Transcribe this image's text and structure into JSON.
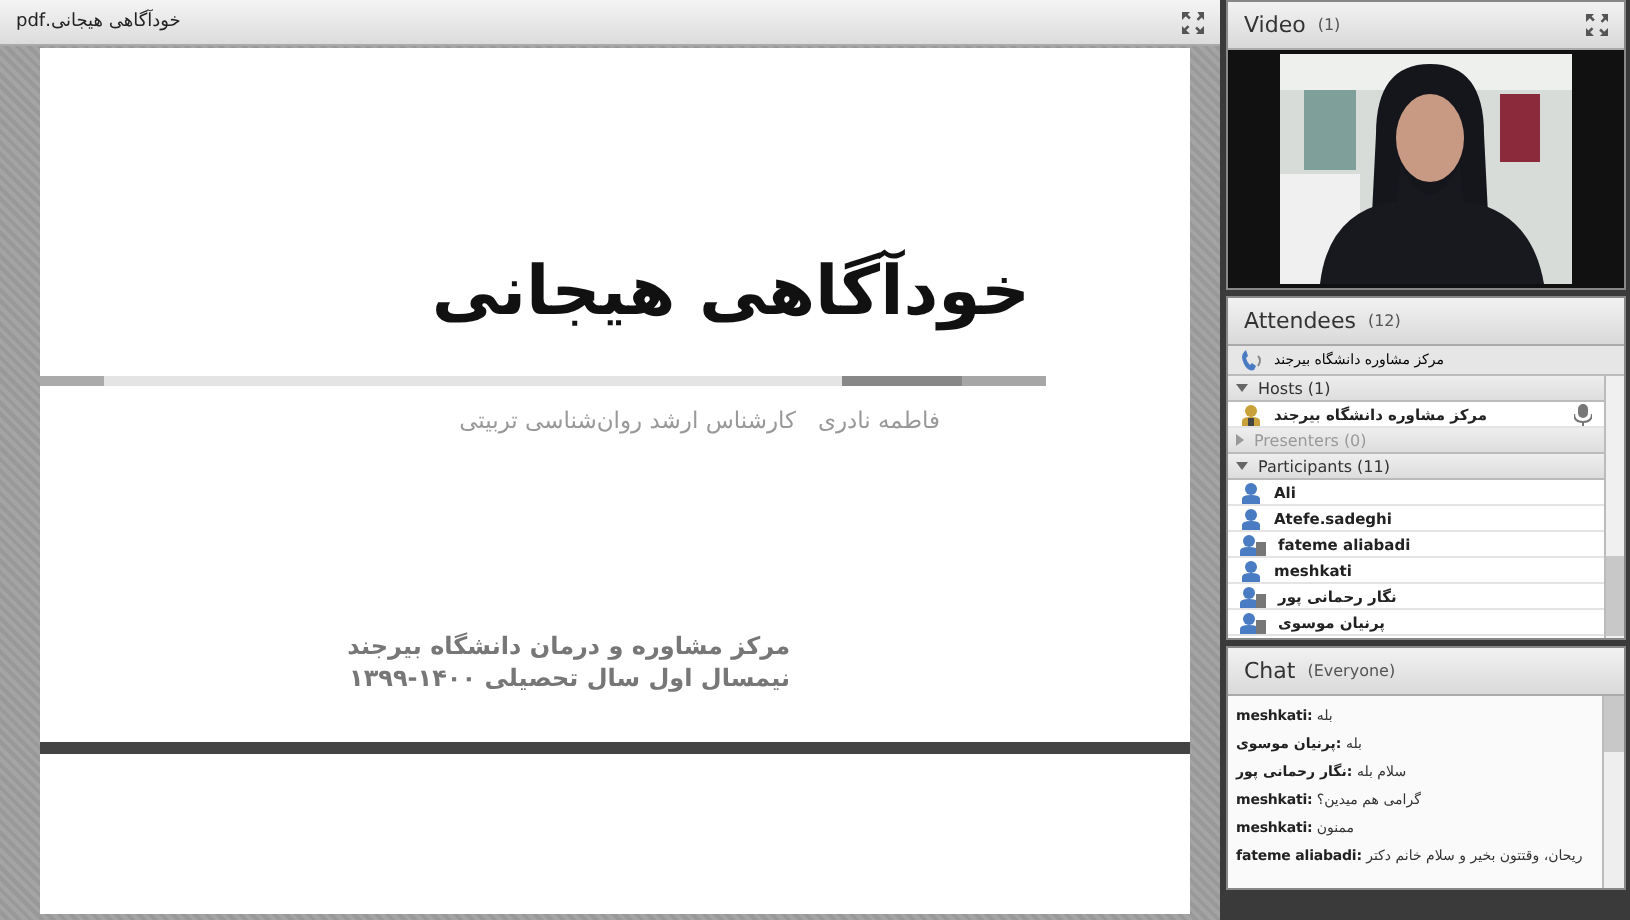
{
  "document_pod": {
    "title": "خودآگاهی هیجانی.pdf",
    "slide": {
      "title": "خودآگاهی هیجانی",
      "presenter": "فاطمه نادری   کارشناس ارشد روان‌شناسی تربیتی",
      "organization": "مرکز مشاوره و درمان دانشگاه بیرجند",
      "term": "نیمسال اول سال تحصیلی ۱۴۰۰-۱۳۹۹"
    }
  },
  "video_pod": {
    "title": "Video",
    "count": "(1)"
  },
  "attendees_pod": {
    "title": "Attendees",
    "count": "(12)",
    "me": "مرکز مشاوره دانشگاه بیرجند",
    "sections": [
      {
        "label": "Hosts (1)",
        "expanded": true,
        "people": [
          {
            "name": "مرکز مشاوره دانشگاه بیرجند",
            "kind": "host"
          }
        ]
      },
      {
        "label": "Presenters (0)",
        "expanded": false
      },
      {
        "label": "Participants (11)",
        "expanded": true,
        "people": [
          {
            "name": "Ali",
            "kind": "single"
          },
          {
            "name": "Atefe.sadeghi",
            "kind": "single"
          },
          {
            "name": "fateme aliabadi",
            "kind": "group"
          },
          {
            "name": "meshkati",
            "kind": "single"
          },
          {
            "name": "نگار رحمانی پور",
            "kind": "group"
          },
          {
            "name": "پرنیان موسوی",
            "kind": "group"
          }
        ]
      }
    ]
  },
  "chat_pod": {
    "title": "Chat",
    "scope": "(Everyone)",
    "messages": [
      {
        "sender": "meshkati:",
        "text": "بله"
      },
      {
        "sender": "پرنیان موسوی:",
        "text": "بله"
      },
      {
        "sender": "نگار رحمانی پور:",
        "text": "سلام بله"
      },
      {
        "sender": "meshkati:",
        "text": "گرامی هم میدین؟"
      },
      {
        "sender": "meshkati:",
        "text": "ممنون"
      },
      {
        "sender": "fateme aliabadi:",
        "text": "ریحان، وقتتون بخیر و سلام خانم دکتر"
      }
    ]
  }
}
